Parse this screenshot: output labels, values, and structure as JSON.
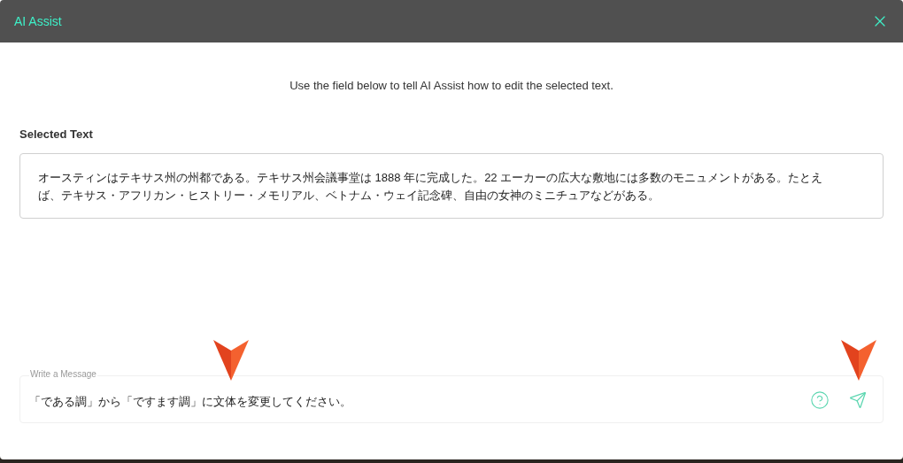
{
  "dialog": {
    "title": "AI Assist"
  },
  "instruction": "Use the field below to tell AI Assist how to edit the selected text.",
  "selected_text": {
    "label": "Selected Text",
    "value": "オースティンはテキサス州の州都である。テキサス州会議事堂は 1888 年に完成した。22 エーカーの広大な敷地には多数のモニュメントがある。たとえば、テキサス・アフリカン・ヒストリー・メモリアル、ベトナム・ウェイ記念碑、自由の女神のミニチュアなどがある。"
  },
  "message": {
    "label": "Write a Message",
    "value": "「である調」から「ですます調」に文体を変更してください。"
  }
}
